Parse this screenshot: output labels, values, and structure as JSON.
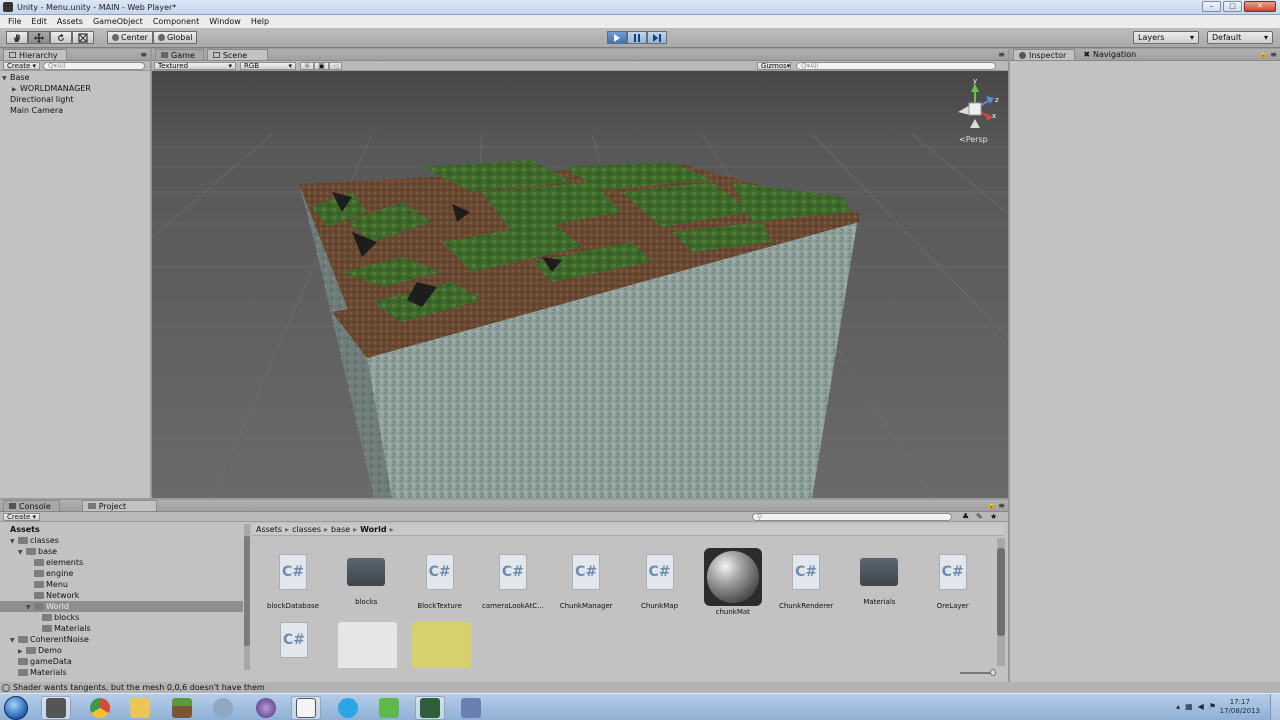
{
  "window": {
    "title": "Unity - Menu.unity - MAIN - Web Player*",
    "minimize": "–",
    "maximize": "□",
    "close": "✕"
  },
  "menu": [
    "File",
    "Edit",
    "Assets",
    "GameObject",
    "Component",
    "Window",
    "Help"
  ],
  "toolbar": {
    "tools": [
      "hand-icon",
      "move-icon",
      "rotate-icon",
      "scale-icon"
    ],
    "pivot_center": "Center",
    "pivot_global": "Global",
    "play_controls": [
      "play-icon",
      "pause-icon",
      "step-icon"
    ],
    "layers": "Layers",
    "layout": "Default"
  },
  "hierarchy": {
    "tab": "Hierarchy",
    "create": "Create",
    "search_placeholder": "Q▾All",
    "items": [
      {
        "label": "Base",
        "depth": 0,
        "arrow": "▼"
      },
      {
        "label": "WORLDMANAGER",
        "depth": 1,
        "arrow": "▶"
      },
      {
        "label": "Directional light",
        "depth": 0,
        "arrow": ""
      },
      {
        "label": "Main Camera",
        "depth": 0,
        "arrow": ""
      }
    ]
  },
  "scene": {
    "tab_game": "Game",
    "tab_scene": "Scene",
    "shading": "Textured",
    "render_mode": "RGB",
    "gizmos": "Gizmos",
    "search_placeholder": "Q▾All",
    "persp": "<Persp",
    "axis_y": "y",
    "axis_z": "z",
    "axis_x": "x"
  },
  "inspector": {
    "tab_inspector": "Inspector",
    "tab_navigation": "Navigation"
  },
  "console": {
    "tab": "Console"
  },
  "project": {
    "tab": "Project",
    "create": "Create",
    "breadcrumb": [
      "Assets",
      "classes",
      "base",
      "World"
    ],
    "breadcrumb_sep": "▸",
    "tree": [
      {
        "label": "Assets",
        "depth": 0,
        "arrow": "",
        "bold": true
      },
      {
        "label": "classes",
        "depth": 1,
        "arrow": "▼"
      },
      {
        "label": "base",
        "depth": 2,
        "arrow": "▼"
      },
      {
        "label": "elements",
        "depth": 3,
        "arrow": ""
      },
      {
        "label": "engine",
        "depth": 3,
        "arrow": ""
      },
      {
        "label": "Menu",
        "depth": 3,
        "arrow": ""
      },
      {
        "label": "Network",
        "depth": 3,
        "arrow": ""
      },
      {
        "label": "World",
        "depth": 3,
        "arrow": "▼",
        "selected": true
      },
      {
        "label": "blocks",
        "depth": 4,
        "arrow": ""
      },
      {
        "label": "Materials",
        "depth": 4,
        "arrow": ""
      },
      {
        "label": "CoherentNoise",
        "depth": 1,
        "arrow": "▼"
      },
      {
        "label": "Demo",
        "depth": 2,
        "arrow": "▶"
      },
      {
        "label": "gameData",
        "depth": 1,
        "arrow": ""
      },
      {
        "label": "Materials",
        "depth": 1,
        "arrow": ""
      }
    ],
    "assets": [
      {
        "label": "blockDatabase",
        "kind": "script"
      },
      {
        "label": "blocks",
        "kind": "folder"
      },
      {
        "label": "BlockTexture",
        "kind": "script"
      },
      {
        "label": "cameraLookAtC...",
        "kind": "script"
      },
      {
        "label": "ChunkManager",
        "kind": "script"
      },
      {
        "label": "ChunkMap",
        "kind": "script"
      },
      {
        "label": "chunkMat",
        "kind": "material"
      },
      {
        "label": "ChunkRenderer",
        "kind": "script"
      },
      {
        "label": "Materials",
        "kind": "folder"
      },
      {
        "label": "OreLayer",
        "kind": "script"
      }
    ],
    "script_glyph": "C#"
  },
  "status": {
    "message": "Shader wants tangents, but the mesh 0,0,6 doesn't have them"
  },
  "taskbar": {
    "time": "17:17",
    "date": "17/08/2013"
  }
}
